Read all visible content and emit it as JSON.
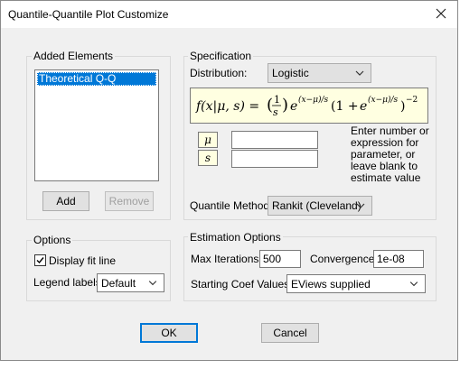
{
  "window": {
    "title": "Quantile-Quantile Plot Customize"
  },
  "added_elements": {
    "label": "Added Elements",
    "items": [
      "Theoretical Q-Q"
    ],
    "add_label": "Add",
    "remove_label": "Remove"
  },
  "specification": {
    "label": "Specification",
    "distribution_label": "Distribution:",
    "distribution_value": "Logistic",
    "formula": "f(x|μ, s) = (1/s) e^(x−μ)/s (1 + e^(x−μ)/s)^−2",
    "params": [
      "μ",
      "s"
    ],
    "param_hint": "Enter number or expression for parameter, or leave blank to estimate value",
    "quantile_label": "Quantile Method:",
    "quantile_value": "Rankit (Cleveland)"
  },
  "options": {
    "label": "Options",
    "display_fit_label": "Display fit line",
    "display_fit_checked": true,
    "legend_label": "Legend labels:",
    "legend_value": "Default"
  },
  "estimation": {
    "label": "Estimation Options",
    "max_iter_label": "Max Iterations:",
    "max_iter_value": "500",
    "convergence_label": "Convergence:",
    "convergence_value": "1e-08",
    "start_coef_label": "Starting Coef Values:",
    "start_coef_value": "EViews supplied"
  },
  "buttons": {
    "ok": "OK",
    "cancel": "Cancel"
  },
  "icons": {
    "close": "close-icon",
    "chevron": "chevron-down-icon",
    "check": "checkmark-icon"
  }
}
